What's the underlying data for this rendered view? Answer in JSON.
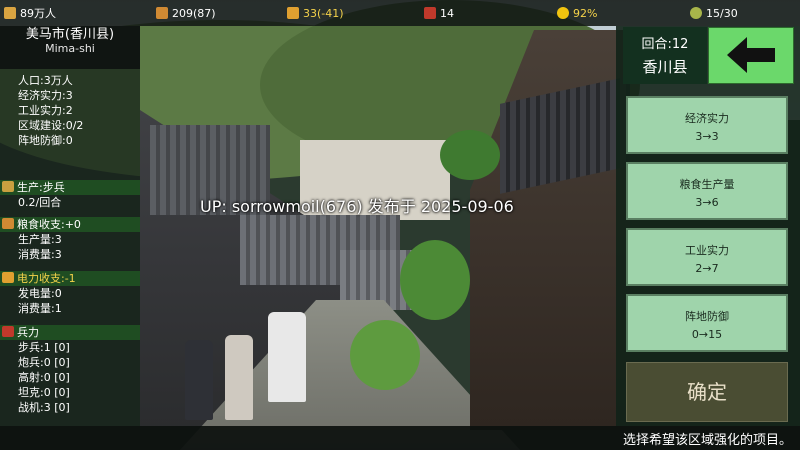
{
  "topbar": {
    "population": "89万人",
    "food": "209(87)",
    "power": "33(-41)",
    "military": "14",
    "approval": "92%",
    "turns": "15/30"
  },
  "city": {
    "name": "美马市(香川县)",
    "roman": "Mima-shi"
  },
  "stats": {
    "population": "人口:3万人",
    "economy": "经济实力:3",
    "industry": "工业实力:2",
    "construction": "区域建设:0/2",
    "defense": "阵地防御:0"
  },
  "production": {
    "header": "生产:步兵",
    "rate": "0.2/回合"
  },
  "food": {
    "header": "粮食收支:+0",
    "produce": "生产量:3",
    "consume": "消费量:3"
  },
  "power": {
    "header": "电力收支:-1",
    "generate": "发电量:0",
    "consume": "消费量:1"
  },
  "troops": {
    "header": "兵力",
    "infantry": "步兵:1 [0]",
    "artillery": "炮兵:0 [0]",
    "antiair": "高射:0 [0]",
    "tank": "坦克:0 [0]",
    "fighter": "战机:3 [0]"
  },
  "watermark": "UP: sorrowmoil(676) 发布于 2025-09-06",
  "round": {
    "label": "回合:12",
    "region": "香川县"
  },
  "options": [
    {
      "title": "经济实力",
      "value": "3→3"
    },
    {
      "title": "粮食生产量",
      "value": "3→6"
    },
    {
      "title": "工业实力",
      "value": "2→7"
    },
    {
      "title": "阵地防御",
      "value": "0→15"
    }
  ],
  "confirm_label": "确定",
  "hint": "选择希望该区域强化的项目。",
  "icons": [
    "population-icon",
    "food-icon",
    "power-icon",
    "military-icon",
    "approval-icon",
    "turn-icon",
    "back-arrow-icon"
  ],
  "colors": {
    "accent_green": "#6bd86b",
    "option_bg": "#9fd4ab",
    "header_green": "#1f4d22",
    "warning_yellow": "#f4d24a"
  }
}
